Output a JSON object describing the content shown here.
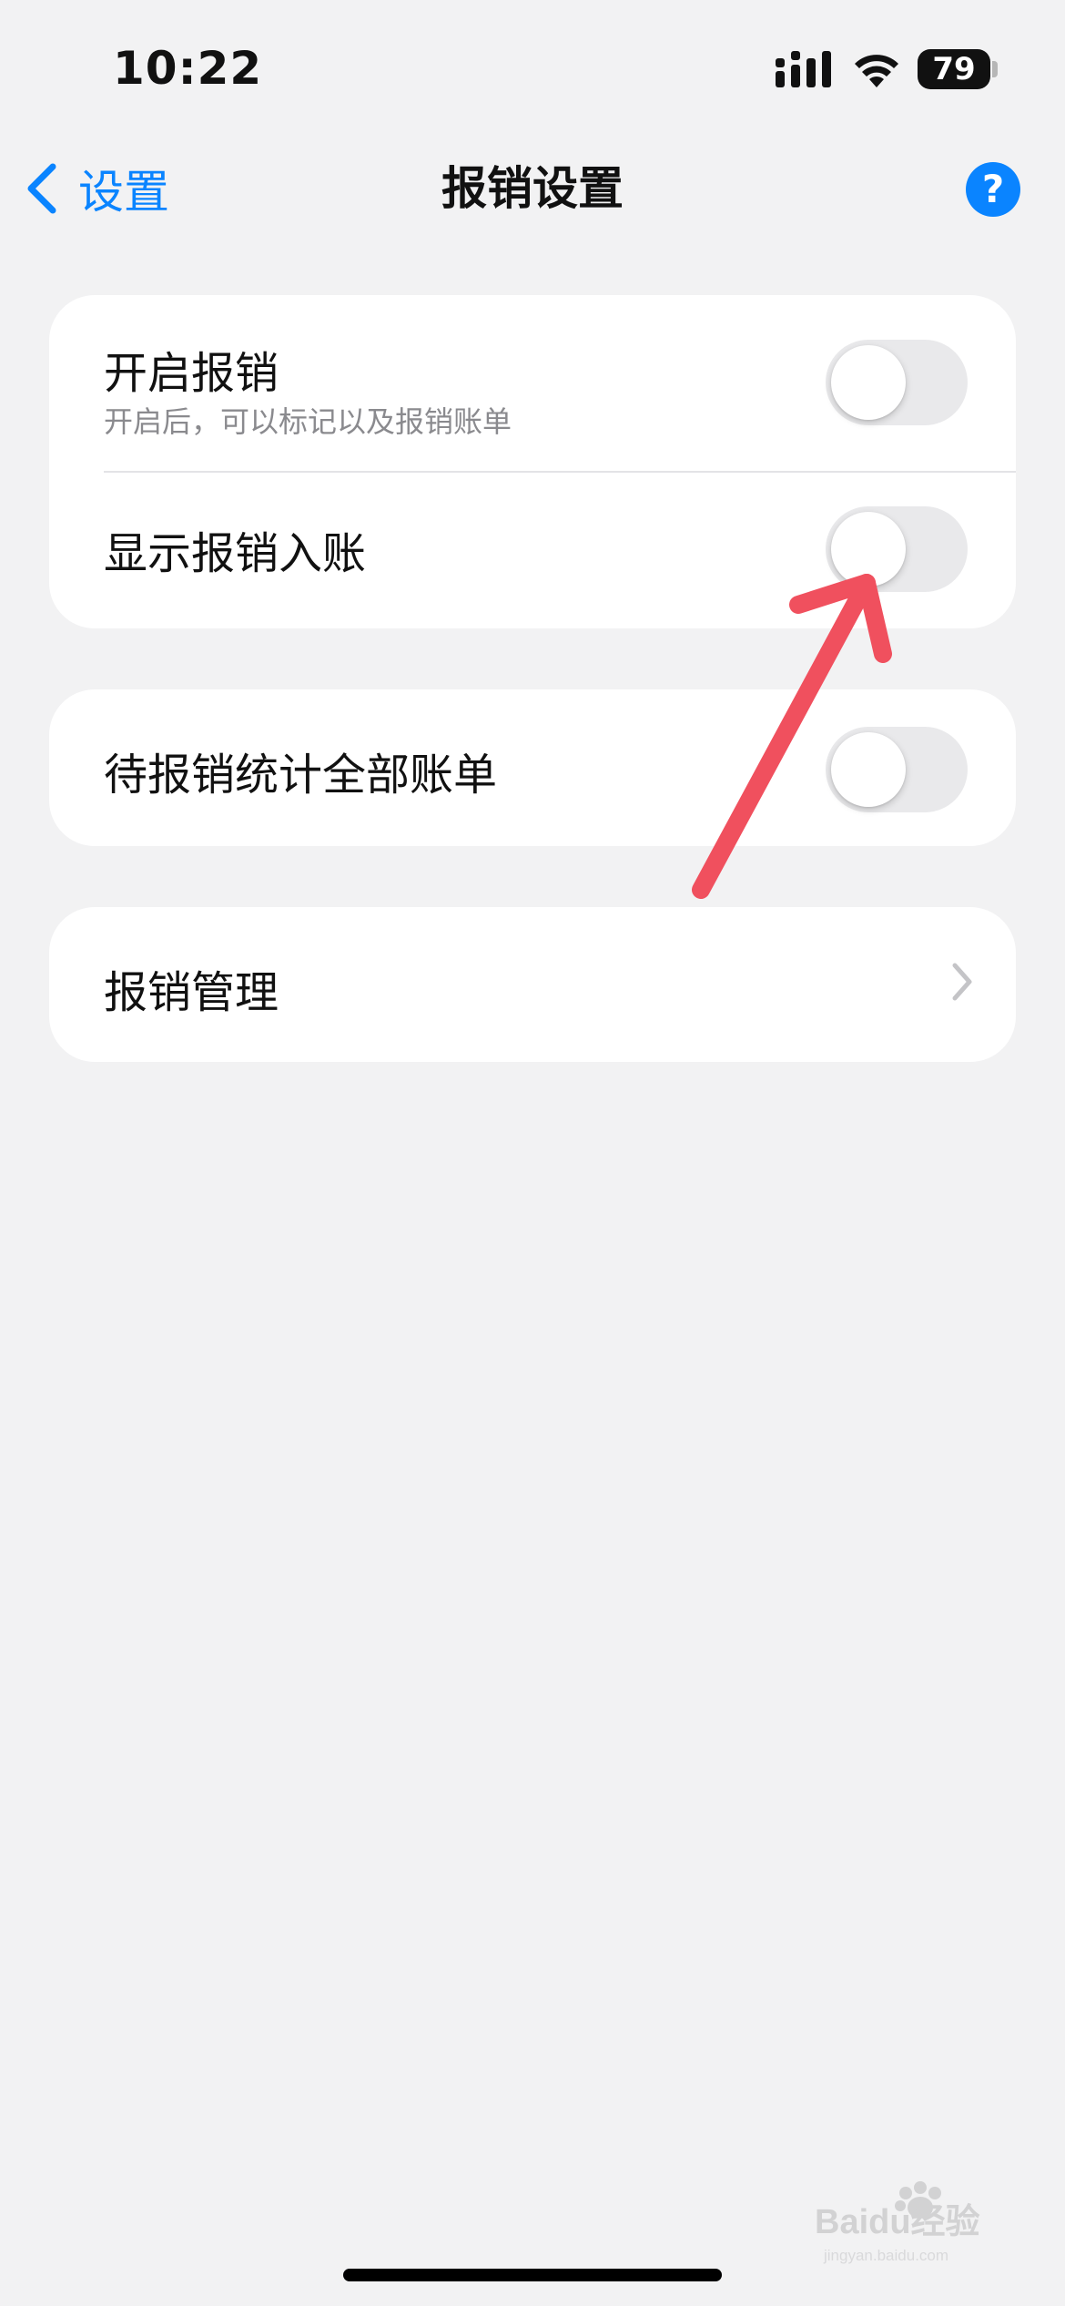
{
  "status_bar": {
    "time": "10:22",
    "battery": "79",
    "signal_icon": "cellular-signal-icon",
    "wifi_icon": "wifi-icon"
  },
  "nav": {
    "back_label": "设置",
    "title": "报销设置",
    "help_label": "?"
  },
  "sections": [
    {
      "rows": [
        {
          "label": "开启报销",
          "subtitle": "开启后，可以标记以及报销账单",
          "control": "toggle",
          "on": false
        },
        {
          "label": "显示报销入账",
          "control": "toggle",
          "on": false
        }
      ]
    },
    {
      "rows": [
        {
          "label": "待报销统计全部账单",
          "control": "toggle",
          "on": false
        }
      ]
    },
    {
      "rows": [
        {
          "label": "报销管理",
          "control": "chevron"
        }
      ]
    }
  ],
  "colors": {
    "accent": "#0a84ff",
    "background": "#f2f2f3",
    "annotation": "#f0505e",
    "toggle_off": "#e9e9eb"
  },
  "watermark": {
    "text": "Baidu经验",
    "subtext": "jingyan.baidu.com"
  }
}
